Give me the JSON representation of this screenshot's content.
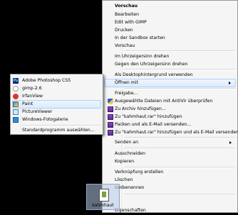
{
  "context_menu": {
    "items": [
      {
        "label": "Vorschau",
        "bold": true
      },
      {
        "label": "Bearbeiten"
      },
      {
        "label": "Edit with GIMP"
      },
      {
        "label": "Drucken"
      },
      {
        "label": "In der Sandbox starten"
      },
      {
        "label": "Vorschau"
      },
      {
        "label": "Im Uhrzeigersinn drehen"
      },
      {
        "label": "Gegen den Uhrzeigersinn drehen"
      },
      {
        "label": "Als Desktophintergrund verwenden"
      },
      {
        "label": "Öffnen mit"
      },
      {
        "label": "Freigabe..."
      },
      {
        "label": "Ausgewählte Dateien mit AntiVir überprüfen",
        "icon": "antivir-shield-icon"
      },
      {
        "label": "Zu Archiv hinzufügen...",
        "icon": "winrar-icon"
      },
      {
        "label": "Zu \"kahmhaut.rar\" hinzufügen",
        "icon": "winrar-icon"
      },
      {
        "label": "Packen und als E-Mail versenden...",
        "icon": "winrar-icon"
      },
      {
        "label": "Zu \"kahmhaut.rar\" hinzufügen und als E-Mail versenden",
        "icon": "winrar-icon"
      },
      {
        "label": "Senden an"
      },
      {
        "label": "Ausschneiden"
      },
      {
        "label": "Kopieren"
      },
      {
        "label": "Verknüpfung erstellen"
      },
      {
        "label": "Löschen"
      },
      {
        "label": "Umbenennen"
      },
      {
        "label": "Eigenschaften"
      }
    ]
  },
  "open_with_menu": {
    "items": [
      {
        "label": "Adobe Photoshop CS5",
        "icon": "photoshop-icon",
        "icon_text": "Ps"
      },
      {
        "label": "gimp-2.6",
        "icon": "gimp-icon"
      },
      {
        "label": "IrfanView",
        "icon": "irfanview-icon"
      },
      {
        "label": "Paint",
        "icon": "paint-icon"
      },
      {
        "label": "PictureViewer",
        "icon": "pictureviewer-icon"
      },
      {
        "label": "Windows-Fotogalerie",
        "icon": "windows-photo-gallery-icon"
      },
      {
        "label": "Standardprogramm auswählen..."
      }
    ]
  },
  "desktop_icon": {
    "label": "kahmhaut"
  },
  "colors": {
    "background": "#000000",
    "menu_bg": "#f5f5f5",
    "highlight_border": "#a8d2f7"
  }
}
